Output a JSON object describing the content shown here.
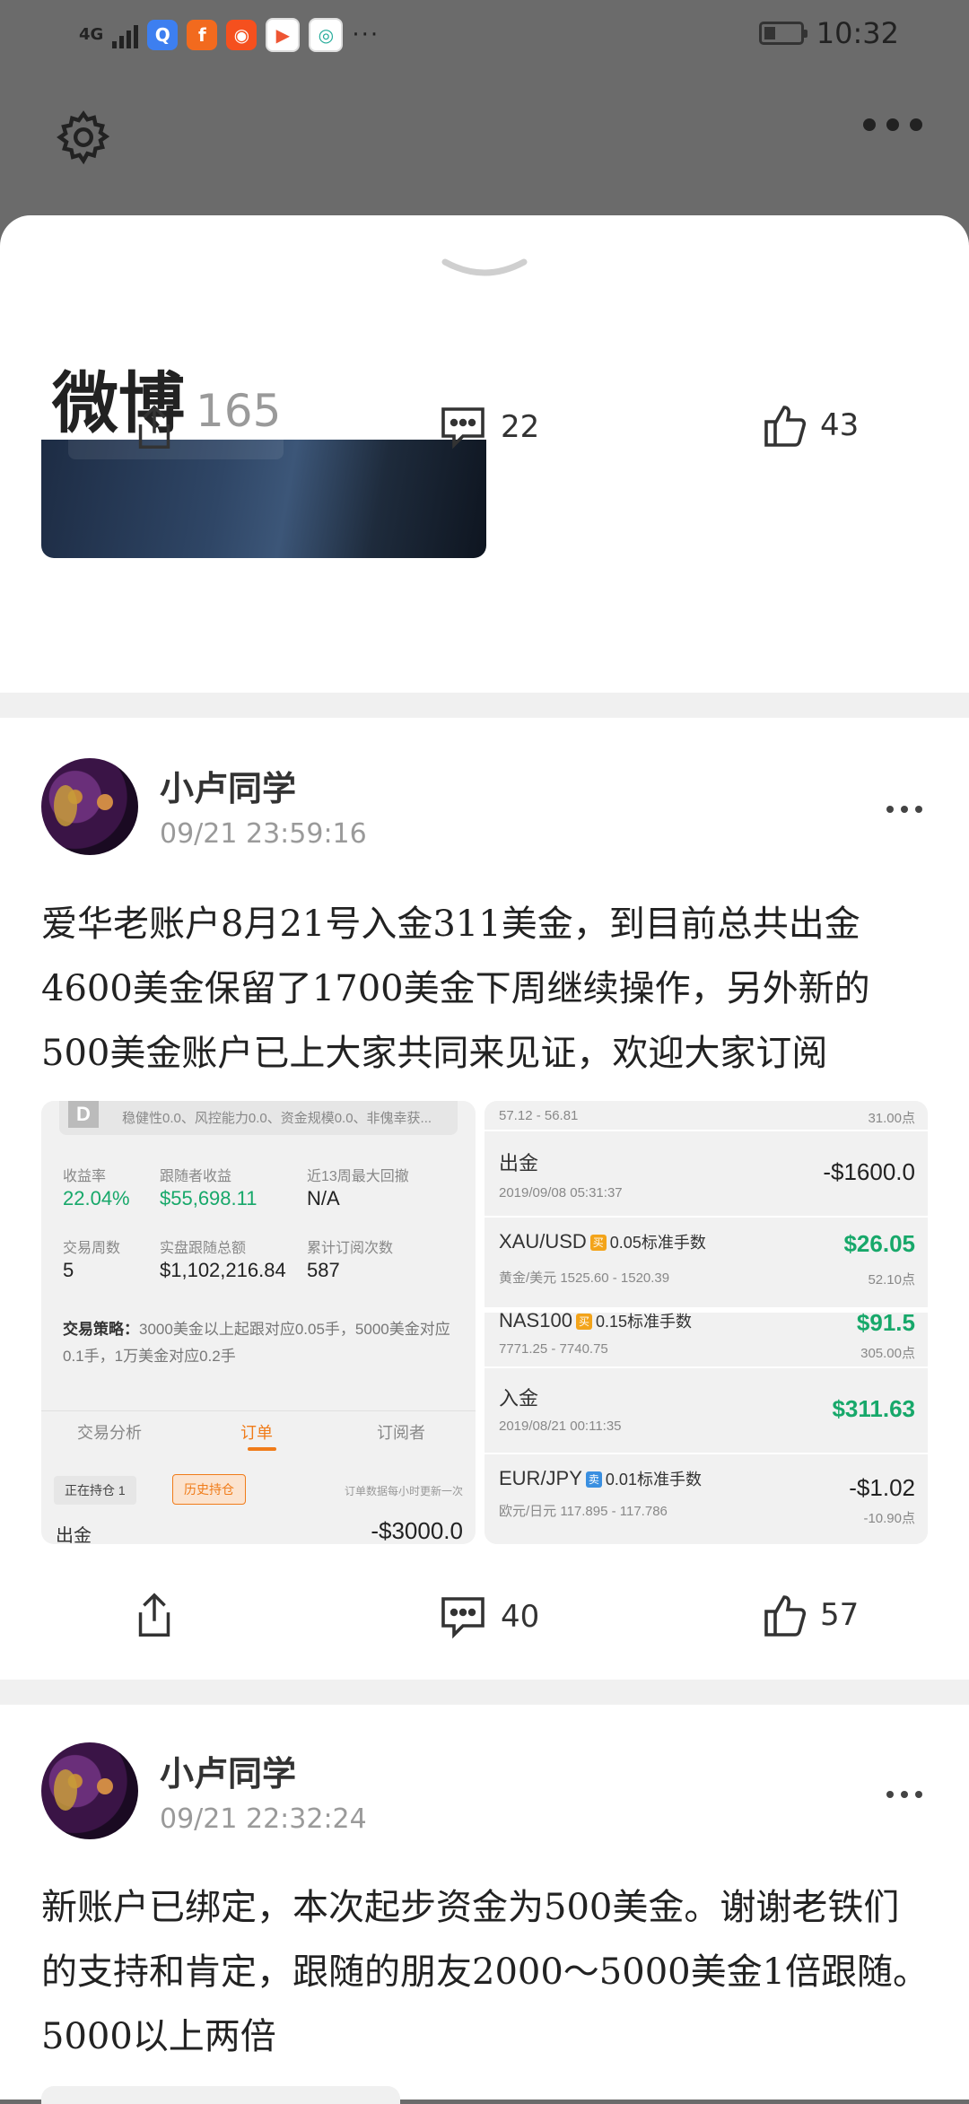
{
  "status_bar": {
    "network": "4G",
    "time": "10:32",
    "app_icons": [
      "browser-icon",
      "flashlight-app-icon",
      "kuaishou-icon",
      "video-player-icon",
      "camera-app-icon"
    ],
    "more": "···"
  },
  "header": {
    "title": "微博",
    "count": "165"
  },
  "post1": {
    "share": "",
    "comments": "22",
    "likes": "43"
  },
  "post2": {
    "username": "小卢同学",
    "timestamp": "09/21 23:59:16",
    "text": "爱华老账户8月21号入金311美金，到目前总共出金4600美金保留了1700美金下周继续操作，另外新的500美金账户已上大家共同来见证，欢迎大家订阅",
    "comments": "40",
    "likes": "57",
    "left_screenshot": {
      "top_banner": "稳健性0.0、风控能力0.0、资金规模0.0、非傀幸获...",
      "stats": [
        {
          "label": "收益率",
          "value": "22.04%"
        },
        {
          "label": "跟随者收益",
          "value": "$55,698.11"
        },
        {
          "label": "近13周最大回撤",
          "value": "N/A"
        },
        {
          "label": "交易周数",
          "value": "5"
        },
        {
          "label": "实盘跟随总额",
          "value": "$1,102,216.84"
        },
        {
          "label": "累计订阅次数",
          "value": "587"
        }
      ],
      "strategy_label": "交易策略：",
      "strategy_text": "3000美金以上起跟对应0.05手，5000美金对应0.1手，1万美金对应0.2手",
      "tabs": [
        "交易分析",
        "订单",
        "订阅者"
      ],
      "chips": [
        "正在持仓 1",
        "历史持仓"
      ],
      "note": "订单数据每小时更新一次",
      "bottom_row_label": "出金",
      "bottom_row_value": "-$3000.0"
    },
    "right_screenshot": {
      "top_range": "57.12 - 56.81",
      "top_points": "31.00点",
      "rows": [
        {
          "title": "出金",
          "sub": "2019/09/08 05:31:37",
          "value": "-$1600.0",
          "points": ""
        },
        {
          "title": "XAU/USD",
          "tag": "买",
          "lots": "0.05标准手数",
          "sub": "黄金/美元   1525.60 - 1520.39",
          "value": "$26.05",
          "points": "52.10点"
        },
        {
          "title": "NAS100",
          "tag": "买",
          "lots": "0.15标准手数",
          "sub": "7771.25 - 7740.75",
          "value": "$91.5",
          "points": "305.00点"
        },
        {
          "title": "入金",
          "sub": "2019/08/21 00:11:35",
          "value": "$311.63",
          "points": ""
        },
        {
          "title": "EUR/JPY",
          "tag": "卖",
          "lots": "0.01标准手数",
          "sub": "欧元/日元   117.895 - 117.786",
          "value": "-$1.02",
          "points": "-10.90点"
        }
      ]
    }
  },
  "post3": {
    "username": "小卢同学",
    "timestamp": "09/21 22:32:24",
    "text": "新账户已绑定，本次起步资金为500美金。谢谢老铁们的支持和肯定，跟随的朋友2000～5000美金1倍跟随。5000以上两倍"
  },
  "colors": {
    "accent_orange": "#f07c1a",
    "profit_green": "#17a86a",
    "background_dim": "#6b6b6b"
  }
}
